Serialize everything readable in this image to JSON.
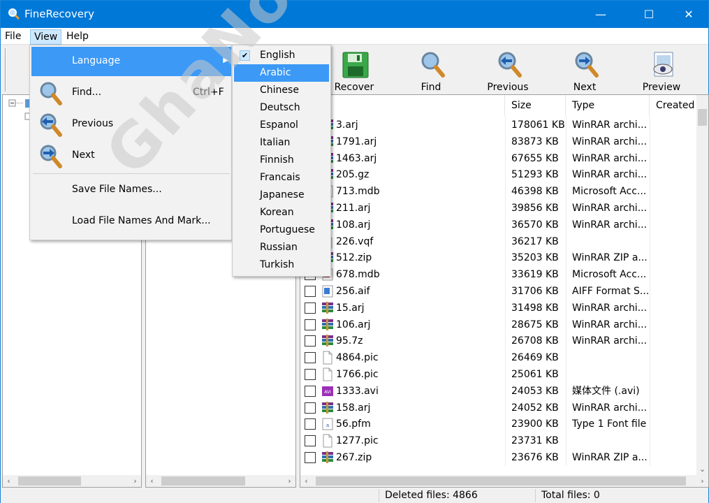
{
  "window": {
    "title": "FineRecovery",
    "minimize": "—",
    "maximize": "☐",
    "close": "✕"
  },
  "menubar": {
    "file": "File",
    "view": "View",
    "help": "Help"
  },
  "toolbar": [
    {
      "label": "Recover",
      "icon": "floppy-disk-icon"
    },
    {
      "label": "Find",
      "icon": "magnifier-icon"
    },
    {
      "label": "Previous",
      "icon": "previous-arrow-magnifier-icon"
    },
    {
      "label": "Next",
      "icon": "next-arrow-magnifier-icon"
    },
    {
      "label": "Preview",
      "icon": "preview-eye-icon"
    }
  ],
  "view_menu": {
    "language": "Language",
    "find": "Find...",
    "find_shortcut": "Ctrl+F",
    "previous": "Previous",
    "next": "Next",
    "save_names": "Save File Names...",
    "load_names": "Load File Names And Mark..."
  },
  "languages": [
    "English",
    "Arabic",
    "Chinese",
    "Deutsch",
    "Espanol",
    "Italian",
    "Finnish",
    "Francais",
    "Japanese",
    "Korean",
    "Portuguese",
    "Russian",
    "Turkish"
  ],
  "language_checked": "English",
  "language_hover": "Arabic",
  "columns": {
    "name": "me",
    "size": "Size",
    "type": "Type",
    "created": "Created"
  },
  "files": [
    {
      "name": "3.arj",
      "size": "178061 KB",
      "type": "WinRAR archi...",
      "icon": "winrar-icon"
    },
    {
      "name": "1791.arj",
      "size": "83873 KB",
      "type": "WinRAR archi...",
      "icon": "winrar-icon"
    },
    {
      "name": "1463.arj",
      "size": "67655 KB",
      "type": "WinRAR archi...",
      "icon": "winrar-icon"
    },
    {
      "name": "205.gz",
      "size": "51293 KB",
      "type": "WinRAR archi...",
      "icon": "winrar-icon"
    },
    {
      "name": "713.mdb",
      "size": "46398 KB",
      "type": "Microsoft Acc...",
      "icon": "access-icon"
    },
    {
      "name": "211.arj",
      "size": "39856 KB",
      "type": "WinRAR archi...",
      "icon": "winrar-icon"
    },
    {
      "name": "108.arj",
      "size": "36570 KB",
      "type": "WinRAR archi...",
      "icon": "winrar-icon"
    },
    {
      "name": "226.vqf",
      "size": "36217 KB",
      "type": "",
      "icon": "blank-file-icon"
    },
    {
      "name": "512.zip",
      "size": "35203 KB",
      "type": "WinRAR ZIP a...",
      "icon": "winrar-icon"
    },
    {
      "name": "678.mdb",
      "size": "33619 KB",
      "type": "Microsoft Acc...",
      "icon": "access-icon"
    },
    {
      "name": "256.aif",
      "size": "31706 KB",
      "type": "AIFF Format S...",
      "icon": "audio-file-icon"
    },
    {
      "name": "15.arj",
      "size": "31498 KB",
      "type": "WinRAR archi...",
      "icon": "winrar-icon"
    },
    {
      "name": "106.arj",
      "size": "28675 KB",
      "type": "WinRAR archi...",
      "icon": "winrar-icon"
    },
    {
      "name": "95.7z",
      "size": "26708 KB",
      "type": "WinRAR archi...",
      "icon": "winrar-icon"
    },
    {
      "name": "4864.pic",
      "size": "26469 KB",
      "type": "",
      "icon": "blank-file-icon"
    },
    {
      "name": "1766.pic",
      "size": "25061 KB",
      "type": "",
      "icon": "blank-file-icon"
    },
    {
      "name": "1333.avi",
      "size": "24053 KB",
      "type": "媒体文件 (.avi)",
      "icon": "avi-file-icon"
    },
    {
      "name": "158.arj",
      "size": "24052 KB",
      "type": "WinRAR archi...",
      "icon": "winrar-icon"
    },
    {
      "name": "56.pfm",
      "size": "23900 KB",
      "type": "Type 1 Font file",
      "icon": "font-file-icon"
    },
    {
      "name": "1277.pic",
      "size": "23731 KB",
      "type": "",
      "icon": "blank-file-icon"
    },
    {
      "name": "267.zip",
      "size": "23676 KB",
      "type": "WinRAR ZIP a...",
      "icon": "winrar-icon"
    }
  ],
  "status": {
    "deleted": "Deleted files: 4866",
    "total": "Total files: 0"
  },
  "watermark": "GhaNou.CoM",
  "colors": {
    "titlebar": "#0078d7",
    "highlight": "#3c99f6",
    "menu_active": "#cce8ff"
  }
}
